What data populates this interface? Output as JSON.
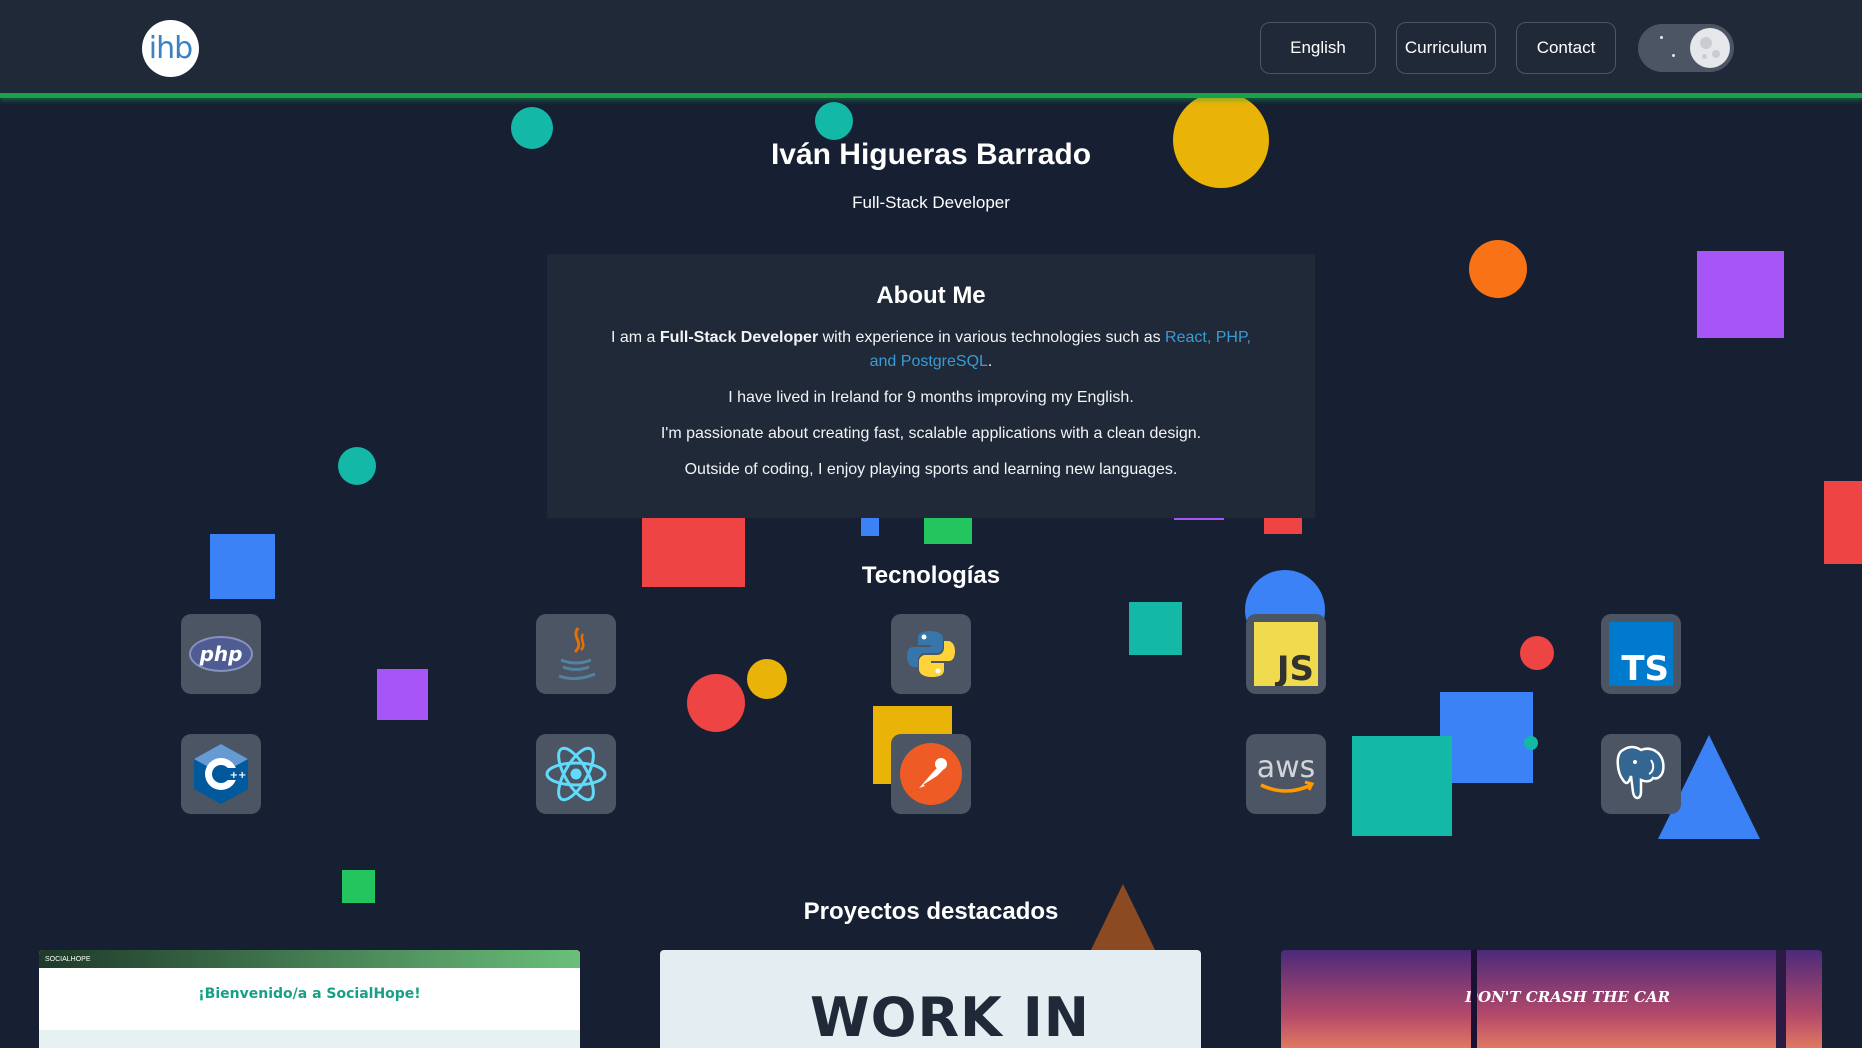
{
  "header": {
    "logo_text": "ihb",
    "nav": [
      {
        "label": "English"
      },
      {
        "label": "Curriculum"
      },
      {
        "label": "Contact"
      }
    ],
    "theme_toggle_icon": "moon-icon"
  },
  "hero": {
    "name": "Iván Higueras Barrado",
    "role": "Full-Stack Developer"
  },
  "about": {
    "title": "About Me",
    "p1_prefix": "I am a ",
    "p1_bold": "Full-Stack Developer",
    "p1_middle": " with experience in various technologies such as ",
    "p1_highlight": "React, PHP, and PostgreSQL",
    "p1_suffix": ".",
    "p2": "I have lived in Ireland for 9 months improving my English.",
    "p3": "I'm passionate about creating fast, scalable applications with a clean design.",
    "p4": "Outside of coding, I enjoy playing sports and learning new languages."
  },
  "technologies": {
    "title": "Tecnologías",
    "items": [
      {
        "name": "php-icon",
        "label": "php"
      },
      {
        "name": "java-icon",
        "label": ""
      },
      {
        "name": "python-icon",
        "label": ""
      },
      {
        "name": "javascript-icon",
        "label": "JS"
      },
      {
        "name": "typescript-icon",
        "label": "TS"
      },
      {
        "name": "cplusplus-icon",
        "label": "C++"
      },
      {
        "name": "react-icon",
        "label": ""
      },
      {
        "name": "postman-icon",
        "label": ""
      },
      {
        "name": "aws-icon",
        "label": "aws"
      },
      {
        "name": "postgresql-icon",
        "label": ""
      }
    ]
  },
  "projects": {
    "title": "Proyectos destacados",
    "cards": [
      {
        "heading": "¡Bienvenido/a a SocialHope!",
        "brand": "SOCIALHOPE"
      },
      {
        "heading": "WORK IN"
      },
      {
        "heading": "DON'T CRASH THE CAR"
      }
    ]
  },
  "colors": {
    "background": "#172033",
    "header": "#1f2937",
    "accent_green": "#16a34a",
    "link": "#3b9bd6"
  }
}
